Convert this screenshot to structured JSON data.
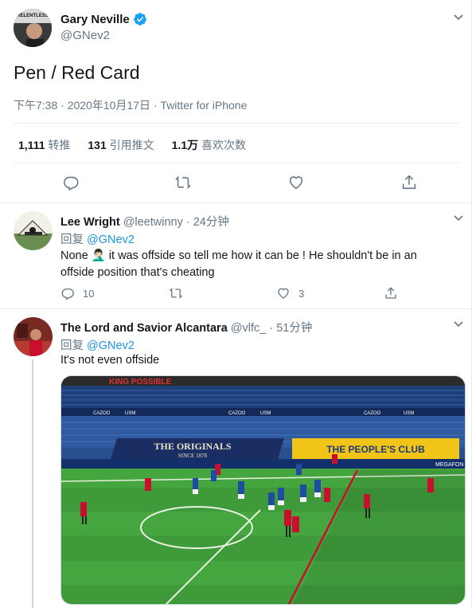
{
  "main_tweet": {
    "name": "Gary Neville",
    "handle": "@GNev2",
    "avatar_text": "RELENTLESS",
    "text": "Pen / Red Card",
    "timestamp": "下午7:38 · 2020年10月17日 · Twitter for iPhone",
    "stats": {
      "retweets_count": "1,111",
      "retweets_label": "转推",
      "quotes_count": "131",
      "quotes_label": "引用推文",
      "likes_count": "1.1万",
      "likes_label": "喜欢次数"
    }
  },
  "replies": [
    {
      "name": "Lee Wright",
      "handle": "@leetwinny",
      "time": " · 24分钟",
      "reply_prefix": "回复 ",
      "reply_to": "@GNev2",
      "text_line1_a": "None ",
      "emoji": "🤦🏻‍♂️",
      "text_line1_b": " it was offside so tell me how it can be ! He shouldn't be in an",
      "text_line2": "offside position that's cheating",
      "reply_count": "10",
      "like_count": "3"
    },
    {
      "name": "The Lord and Savior Alcantara",
      "handle": "@vlfc_",
      "time": " · 51分钟",
      "reply_prefix": "回复 ",
      "reply_to": "@GNev2",
      "text": "It's not even offside",
      "media": {
        "stand_banner": "THE ORIGINALS",
        "stand_banner_sub": "SINCE 1878",
        "peoples_club": "THE PEOPLE'S CLUB",
        "sponsor": "CAZOO",
        "sponsor2": "USM",
        "sponsor3": "MEGAFON",
        "top_text": "KING POSSIBLE"
      }
    }
  ],
  "colors": {
    "blue": "#1da1f2",
    "link": "#1b95e0",
    "grey": "#657786",
    "pitch": "#3f9b3a"
  }
}
